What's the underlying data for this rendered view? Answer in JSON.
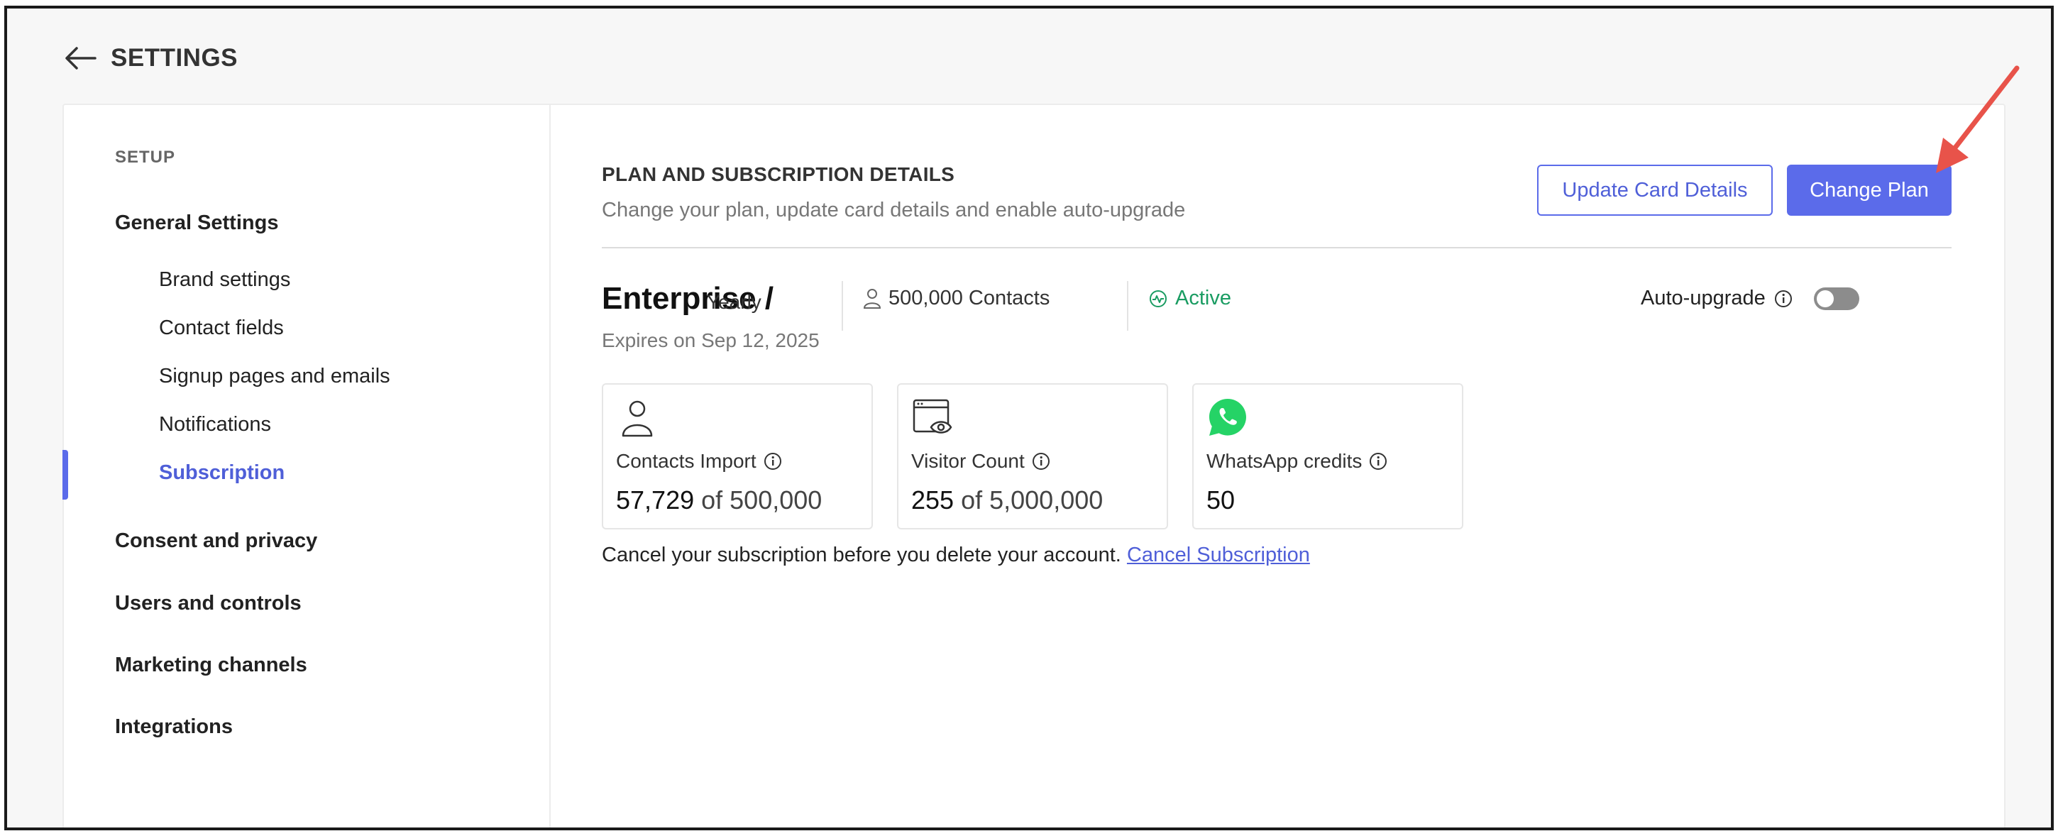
{
  "header": {
    "title": "SETTINGS"
  },
  "sidebar": {
    "section_label": "SETUP",
    "groups": [
      {
        "label": "General Settings"
      },
      {
        "label": "Consent and privacy"
      },
      {
        "label": "Users and controls"
      },
      {
        "label": "Marketing channels"
      },
      {
        "label": "Integrations"
      }
    ],
    "sub_items": [
      {
        "label": "Brand settings"
      },
      {
        "label": "Contact fields"
      },
      {
        "label": "Signup pages and emails"
      },
      {
        "label": "Notifications"
      },
      {
        "label": "Subscription"
      }
    ]
  },
  "main": {
    "title": "PLAN AND SUBSCRIPTION DETAILS",
    "description": "Change your plan, update card details and enable auto-upgrade",
    "update_card_button": "Update Card Details",
    "change_plan_button": "Change Plan",
    "plan": {
      "name": "Enterprise /",
      "cycle": "Yearly",
      "contacts": "500,000 Contacts",
      "status": "Active",
      "expires": "Expires on Sep 12, 2025"
    },
    "auto_upgrade": {
      "label": "Auto-upgrade",
      "enabled": false
    },
    "cards": [
      {
        "label": "Contacts Import",
        "value": "57,729",
        "of": "of 500,000",
        "icon": "person-icon"
      },
      {
        "label": "Visitor Count",
        "value": "255",
        "of": "of 5,000,000",
        "icon": "browser-eye-icon"
      },
      {
        "label": "WhatsApp credits",
        "value": "50",
        "of": "",
        "icon": "whatsapp-icon"
      }
    ],
    "cancel_text": "Cancel your subscription before you delete your account.",
    "cancel_link": "Cancel Subscription"
  },
  "colors": {
    "accent": "#5b6bea",
    "active_status": "#1a9c62",
    "whatsapp": "#25d366",
    "annotation_arrow": "#e8534a"
  }
}
